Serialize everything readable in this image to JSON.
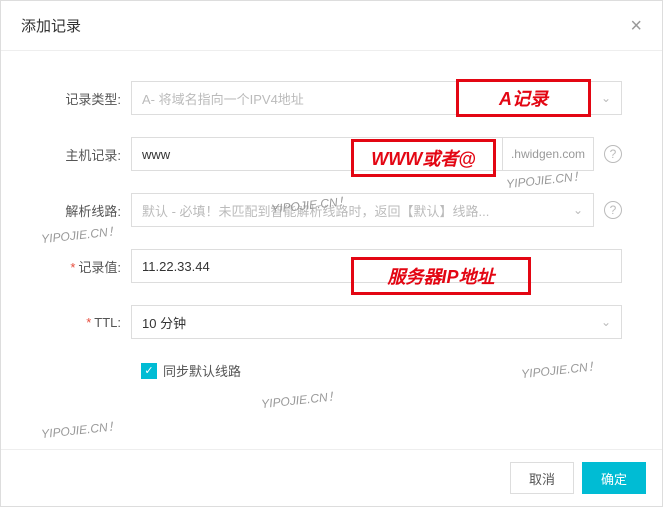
{
  "dialog": {
    "title": "添加记录",
    "close": "×"
  },
  "form": {
    "record_type": {
      "label": "记录类型:",
      "placeholder": "A- 将域名指向一个IPV4地址"
    },
    "host": {
      "label": "主机记录:",
      "value": "www",
      "suffix": ".hwidgen.com"
    },
    "line": {
      "label": "解析线路:",
      "placeholder": "默认 - 必填！未匹配到智能解析线路时，返回【默认】线路..."
    },
    "value": {
      "label": "记录值:",
      "value": "11.22.33.44"
    },
    "ttl": {
      "label": "TTL:",
      "value": "10 分钟"
    },
    "sync": {
      "label": "同步默认线路"
    }
  },
  "footer": {
    "cancel": "取消",
    "ok": "确定"
  },
  "annotations": {
    "a_record": "A记录",
    "www_or_at": "WWW或者@",
    "server_ip": "服务器IP地址"
  },
  "watermark": "YIPOJIE.CN！"
}
